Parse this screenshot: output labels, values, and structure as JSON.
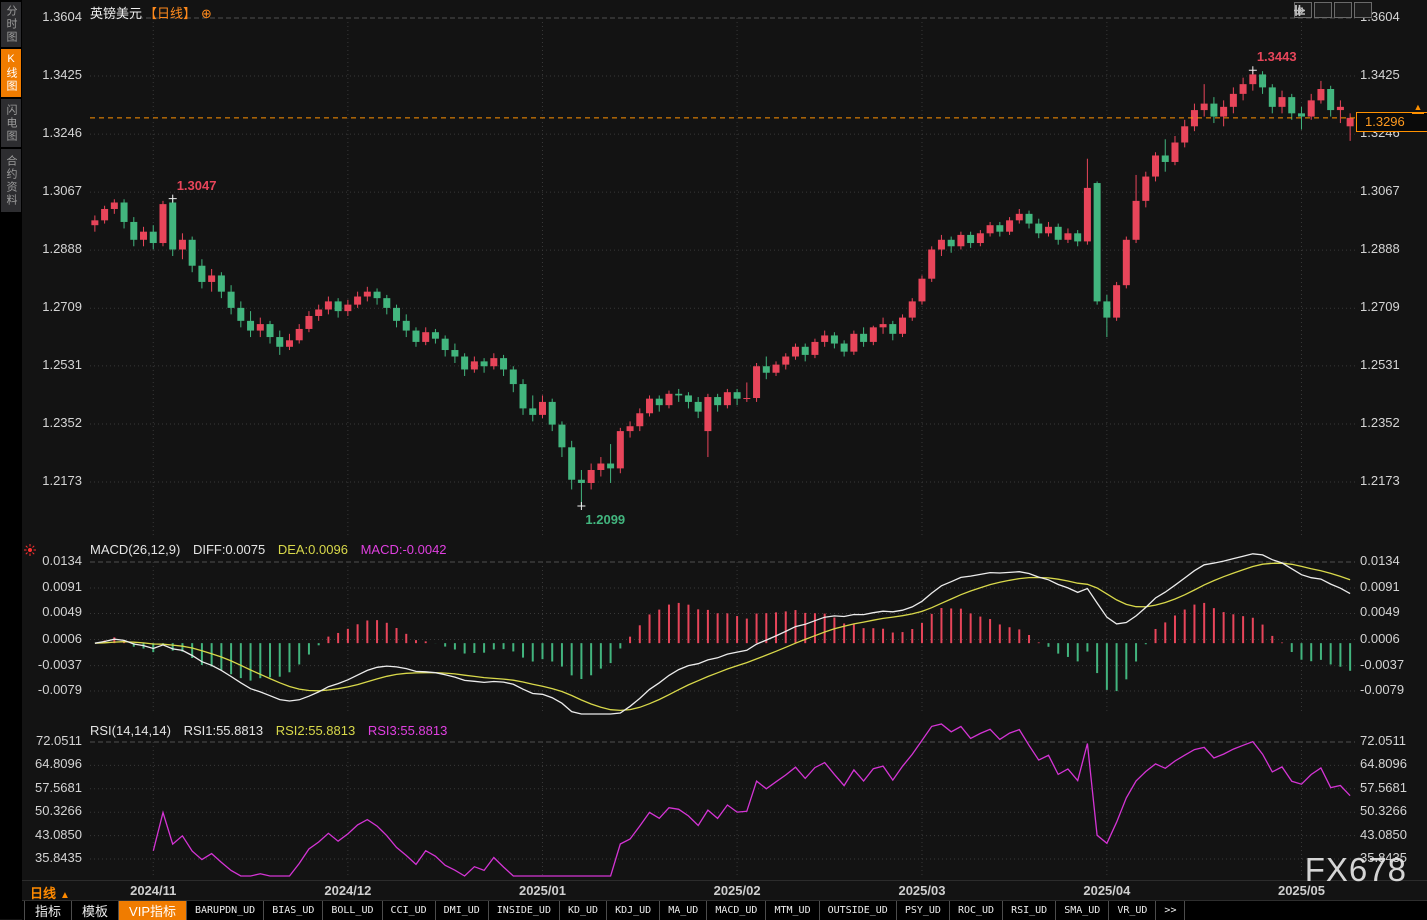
{
  "sidebar": {
    "tabs": [
      {
        "label": "分时图",
        "active": false
      },
      {
        "label": "K线图",
        "active": true
      },
      {
        "label": "闪电图",
        "active": false
      },
      {
        "label": "合约资料",
        "active": false
      }
    ]
  },
  "header": {
    "symbol": "英镑美元",
    "period": "【日线】",
    "plus_icon": "⊕"
  },
  "top_right_tools": [
    "crosshair-icon",
    "y-axis-scale-icon",
    "x-axis-scale-icon",
    "scroll-to-latest-icon"
  ],
  "main": {
    "current_price_label": "1.3296"
  },
  "macd_header": {
    "params": "MACD(26,12,9)",
    "diff": "DIFF:0.0075",
    "dea": "DEA:0.0096",
    "macd": "MACD:-0.0042"
  },
  "rsi_header": {
    "params": "RSI(14,14,14)",
    "rsi1": "RSI1:55.8813",
    "rsi2": "RSI2:55.8813",
    "rsi3": "RSI3:55.8813"
  },
  "time_axis": {
    "timeframe": "日线",
    "arrow": "▲"
  },
  "toolbar": {
    "tabs": [
      "指标",
      "模板"
    ],
    "vip": "VIP指标",
    "indicators": [
      "BARUPDN_UD",
      "BIAS_UD",
      "BOLL_UD",
      "CCI_UD",
      "DMI_UD",
      "INSIDE_UD",
      "KD_UD",
      "KDJ_UD",
      "MA_UD",
      "MACD_UD",
      "MTM_UD",
      "OUTSIDE_UD",
      "PSY_UD",
      "ROC_UD",
      "RSI_UD",
      "SMA_UD",
      "VR_UD"
    ],
    "more": ">>"
  },
  "watermark": "FX678",
  "colors": {
    "up": "#e8455a",
    "down": "#42b57e",
    "accent": "#ff9100",
    "dea_yellow": "#d8d84a",
    "diff_white": "#ececec",
    "magenta": "#d434d4",
    "grid": "#383838",
    "boundary": "#4f4f4f",
    "axis_text": "#d4d4d4",
    "vip_bg": "#f07c00",
    "marker": "#f0f0f0"
  },
  "chart_data": {
    "type": "candlestick",
    "title": "英镑美元【日线】 (GBP/USD daily)",
    "legend_position": "top-left",
    "grid": true,
    "current_price": 1.3296,
    "price_axis_ticks": [
      {
        "v": 1.3604,
        "label": "1.3604"
      },
      {
        "v": 1.3425,
        "label": "1.3425"
      },
      {
        "v": 1.3246,
        "label": "1.3246"
      },
      {
        "v": 1.3067,
        "label": "1.3067"
      },
      {
        "v": 1.2888,
        "label": "1.2888"
      },
      {
        "v": 1.2709,
        "label": "1.2709"
      },
      {
        "v": 1.2531,
        "label": "1.2531"
      },
      {
        "v": 1.2352,
        "label": "1.2352"
      },
      {
        "v": 1.2173,
        "label": "1.2173"
      }
    ],
    "macd_axis_ticks": [
      {
        "v": 0.0134,
        "label": "0.0134"
      },
      {
        "v": 0.0091,
        "label": "0.0091"
      },
      {
        "v": 0.0049,
        "label": "0.0049"
      },
      {
        "v": 0.0006,
        "label": "0.0006"
      },
      {
        "v": -0.0037,
        "label": "-0.0037"
      },
      {
        "v": -0.0079,
        "label": "-0.0079"
      }
    ],
    "rsi_axis_ticks": [
      {
        "v": 72.0511,
        "label": "72.0511"
      },
      {
        "v": 64.8096,
        "label": "64.8096"
      },
      {
        "v": 57.5681,
        "label": "57.5681"
      },
      {
        "v": 50.3266,
        "label": "50.3266"
      },
      {
        "v": 43.085,
        "label": "43.0850"
      },
      {
        "v": 35.8435,
        "label": "35.8435"
      }
    ],
    "months": [
      {
        "label": "2024/11",
        "candle": 6
      },
      {
        "label": "2024/12",
        "candle": 26
      },
      {
        "label": "2025/01",
        "candle": 46
      },
      {
        "label": "2025/02",
        "candle": 66
      },
      {
        "label": "2025/03",
        "candle": 85
      },
      {
        "label": "2025/04",
        "candle": 104
      },
      {
        "label": "2025/05",
        "candle": 124
      }
    ],
    "annotations": [
      {
        "candle": 8,
        "price": 1.3047,
        "label": "1.3047",
        "color": "#e8455a",
        "side": "right-above"
      },
      {
        "candle": 119,
        "price": 1.3443,
        "label": "1.3443",
        "color": "#e8455a",
        "side": "right-above"
      },
      {
        "candle": 50,
        "price": 1.2099,
        "label": "1.2099",
        "color": "#42b57e",
        "side": "right-below"
      }
    ],
    "macd_params": [
      26,
      12,
      9
    ],
    "macd_current": {
      "diff": 0.0075,
      "dea": 0.0096,
      "macd": -0.0042
    },
    "rsi_params": [
      14,
      14,
      14
    ],
    "rsi_current": 55.8813,
    "candles": [
      [
        1.2965,
        1.2995,
        1.2945,
        1.298
      ],
      [
        1.298,
        1.3025,
        1.297,
        1.3015
      ],
      [
        1.3015,
        1.3045,
        1.3,
        1.3035
      ],
      [
        1.3035,
        1.3045,
        1.2955,
        1.2975
      ],
      [
        1.2975,
        1.299,
        1.29,
        1.292
      ],
      [
        1.292,
        1.296,
        1.29,
        1.2945
      ],
      [
        1.2945,
        1.2965,
        1.289,
        1.291
      ],
      [
        1.291,
        1.304,
        1.29,
        1.303
      ],
      [
        1.3035,
        1.3047,
        1.287,
        1.289
      ],
      [
        1.289,
        1.294,
        1.286,
        1.292
      ],
      [
        1.292,
        1.293,
        1.282,
        1.284
      ],
      [
        1.284,
        1.286,
        1.277,
        1.279
      ],
      [
        1.279,
        1.283,
        1.276,
        1.281
      ],
      [
        1.281,
        1.282,
        1.274,
        1.276
      ],
      [
        1.276,
        1.278,
        1.269,
        1.271
      ],
      [
        1.271,
        1.273,
        1.265,
        1.267
      ],
      [
        1.267,
        1.27,
        1.262,
        1.264
      ],
      [
        1.264,
        1.268,
        1.262,
        1.266
      ],
      [
        1.266,
        1.267,
        1.26,
        1.262
      ],
      [
        1.262,
        1.264,
        1.2565,
        1.259
      ],
      [
        1.259,
        1.263,
        1.258,
        1.261
      ],
      [
        1.261,
        1.266,
        1.26,
        1.2645
      ],
      [
        1.2645,
        1.27,
        1.2635,
        1.2685
      ],
      [
        1.2685,
        1.272,
        1.267,
        1.2705
      ],
      [
        1.2705,
        1.2745,
        1.269,
        1.273
      ],
      [
        1.273,
        1.274,
        1.268,
        1.27
      ],
      [
        1.27,
        1.2735,
        1.2685,
        1.272
      ],
      [
        1.272,
        1.276,
        1.271,
        1.2745
      ],
      [
        1.2745,
        1.2775,
        1.273,
        1.276
      ],
      [
        1.276,
        1.277,
        1.272,
        1.274
      ],
      [
        1.274,
        1.275,
        1.269,
        1.271
      ],
      [
        1.271,
        1.272,
        1.265,
        1.267
      ],
      [
        1.267,
        1.269,
        1.262,
        1.264
      ],
      [
        1.264,
        1.265,
        1.259,
        1.2605
      ],
      [
        1.2605,
        1.265,
        1.2595,
        1.2635
      ],
      [
        1.2635,
        1.2645,
        1.26,
        1.2615
      ],
      [
        1.2615,
        1.2625,
        1.256,
        1.258
      ],
      [
        1.258,
        1.26,
        1.254,
        1.256
      ],
      [
        1.256,
        1.257,
        1.25,
        1.252
      ],
      [
        1.252,
        1.256,
        1.251,
        1.2545
      ],
      [
        1.2545,
        1.2555,
        1.251,
        1.253
      ],
      [
        1.253,
        1.257,
        1.252,
        1.2555
      ],
      [
        1.2555,
        1.2565,
        1.25,
        1.252
      ],
      [
        1.252,
        1.253,
        1.245,
        1.2475
      ],
      [
        1.2475,
        1.249,
        1.238,
        1.24
      ],
      [
        1.24,
        1.244,
        1.236,
        1.238
      ],
      [
        1.238,
        1.244,
        1.237,
        1.242
      ],
      [
        1.242,
        1.243,
        1.233,
        1.235
      ],
      [
        1.235,
        1.236,
        1.225,
        1.228
      ],
      [
        1.228,
        1.23,
        1.215,
        1.218
      ],
      [
        1.218,
        1.221,
        1.2099,
        1.217
      ],
      [
        1.217,
        1.223,
        1.215,
        1.221
      ],
      [
        1.221,
        1.225,
        1.219,
        1.223
      ],
      [
        1.223,
        1.229,
        1.217,
        1.2215
      ],
      [
        1.2215,
        1.234,
        1.22,
        1.233
      ],
      [
        1.233,
        1.236,
        1.231,
        1.2345
      ],
      [
        1.2345,
        1.24,
        1.233,
        1.2385
      ],
      [
        1.2385,
        1.244,
        1.2375,
        1.243
      ],
      [
        1.243,
        1.244,
        1.239,
        1.241
      ],
      [
        1.241,
        1.2455,
        1.24,
        1.2445
      ],
      [
        1.2445,
        1.246,
        1.242,
        1.244
      ],
      [
        1.244,
        1.245,
        1.24,
        1.242
      ],
      [
        1.242,
        1.2435,
        1.237,
        1.239
      ],
      [
        1.233,
        1.2445,
        1.225,
        1.2435
      ],
      [
        1.2435,
        1.2445,
        1.239,
        1.241
      ],
      [
        1.241,
        1.246,
        1.24,
        1.245
      ],
      [
        1.245,
        1.246,
        1.241,
        1.243
      ],
      [
        1.243,
        1.248,
        1.242,
        1.2432
      ],
      [
        1.2432,
        1.254,
        1.242,
        1.253
      ],
      [
        1.253,
        1.256,
        1.249,
        1.251
      ],
      [
        1.251,
        1.2545,
        1.25,
        1.2535
      ],
      [
        1.2535,
        1.257,
        1.252,
        1.256
      ],
      [
        1.256,
        1.26,
        1.255,
        1.259
      ],
      [
        1.259,
        1.26,
        1.2545,
        1.2565
      ],
      [
        1.2565,
        1.2615,
        1.2555,
        1.2605
      ],
      [
        1.2605,
        1.264,
        1.259,
        1.2625
      ],
      [
        1.2625,
        1.2635,
        1.2585,
        1.26
      ],
      [
        1.26,
        1.261,
        1.256,
        1.2575
      ],
      [
        1.2575,
        1.264,
        1.2565,
        1.263
      ],
      [
        1.263,
        1.265,
        1.259,
        1.2605
      ],
      [
        1.2605,
        1.2655,
        1.2595,
        1.265
      ],
      [
        1.265,
        1.268,
        1.263,
        1.266
      ],
      [
        1.266,
        1.267,
        1.261,
        1.263
      ],
      [
        1.263,
        1.269,
        1.262,
        1.268
      ],
      [
        1.268,
        1.274,
        1.267,
        1.273
      ],
      [
        1.273,
        1.281,
        1.272,
        1.28
      ],
      [
        1.28,
        1.29,
        1.279,
        1.289
      ],
      [
        1.289,
        1.2935,
        1.287,
        1.292
      ],
      [
        1.292,
        1.293,
        1.288,
        1.29
      ],
      [
        1.29,
        1.2945,
        1.289,
        1.2935
      ],
      [
        1.2935,
        1.2945,
        1.2895,
        1.291
      ],
      [
        1.291,
        1.295,
        1.29,
        1.294
      ],
      [
        1.294,
        1.2975,
        1.293,
        1.2965
      ],
      [
        1.2965,
        1.2975,
        1.293,
        1.2945
      ],
      [
        1.2945,
        1.299,
        1.2935,
        1.298
      ],
      [
        1.298,
        1.3015,
        1.297,
        1.3
      ],
      [
        1.3,
        1.301,
        1.2955,
        1.297
      ],
      [
        1.297,
        1.2985,
        1.2925,
        1.294
      ],
      [
        1.294,
        1.2975,
        1.293,
        1.296
      ],
      [
        1.296,
        1.297,
        1.2905,
        1.292
      ],
      [
        1.292,
        1.2955,
        1.291,
        1.294
      ],
      [
        1.294,
        1.295,
        1.29,
        1.2915
      ],
      [
        1.2915,
        1.317,
        1.2905,
        1.308
      ],
      [
        1.3095,
        1.31,
        1.272,
        1.273
      ],
      [
        1.273,
        1.275,
        1.262,
        1.268
      ],
      [
        1.268,
        1.279,
        1.267,
        1.278
      ],
      [
        1.278,
        1.293,
        1.277,
        1.292
      ],
      [
        1.292,
        1.312,
        1.291,
        1.304
      ],
      [
        1.304,
        1.313,
        1.302,
        1.3115
      ],
      [
        1.3115,
        1.319,
        1.31,
        1.318
      ],
      [
        1.318,
        1.323,
        1.313,
        1.316
      ],
      [
        1.316,
        1.324,
        1.315,
        1.322
      ],
      [
        1.322,
        1.329,
        1.3205,
        1.327
      ],
      [
        1.327,
        1.334,
        1.3255,
        1.332
      ],
      [
        1.332,
        1.34,
        1.33,
        1.334
      ],
      [
        1.334,
        1.336,
        1.328,
        1.33
      ],
      [
        1.33,
        1.335,
        1.327,
        1.333
      ],
      [
        1.333,
        1.339,
        1.331,
        1.337
      ],
      [
        1.337,
        1.342,
        1.335,
        1.34
      ],
      [
        1.34,
        1.3443,
        1.338,
        1.343
      ],
      [
        1.343,
        1.344,
        1.337,
        1.339
      ],
      [
        1.339,
        1.34,
        1.331,
        1.333
      ],
      [
        1.333,
        1.338,
        1.331,
        1.336
      ],
      [
        1.336,
        1.337,
        1.329,
        1.331
      ],
      [
        1.331,
        1.333,
        1.326,
        1.33
      ],
      [
        1.33,
        1.337,
        1.329,
        1.335
      ],
      [
        1.335,
        1.341,
        1.334,
        1.3385
      ],
      [
        1.3385,
        1.3395,
        1.33,
        1.332
      ],
      [
        1.332,
        1.335,
        1.328,
        1.333
      ],
      [
        1.327,
        1.331,
        1.3225,
        1.3296
      ]
    ]
  }
}
